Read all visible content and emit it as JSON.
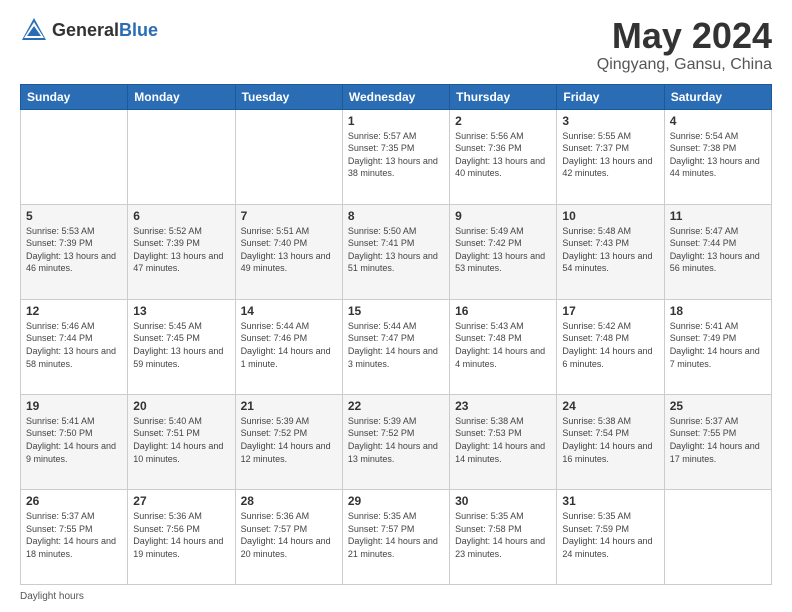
{
  "header": {
    "logo_general": "General",
    "logo_blue": "Blue",
    "month_title": "May 2024",
    "location": "Qingyang, Gansu, China"
  },
  "days_of_week": [
    "Sunday",
    "Monday",
    "Tuesday",
    "Wednesday",
    "Thursday",
    "Friday",
    "Saturday"
  ],
  "weeks": [
    [
      {
        "num": "",
        "sunrise": "",
        "sunset": "",
        "daylight": ""
      },
      {
        "num": "",
        "sunrise": "",
        "sunset": "",
        "daylight": ""
      },
      {
        "num": "",
        "sunrise": "",
        "sunset": "",
        "daylight": ""
      },
      {
        "num": "1",
        "sunrise": "Sunrise: 5:57 AM",
        "sunset": "Sunset: 7:35 PM",
        "daylight": "Daylight: 13 hours and 38 minutes."
      },
      {
        "num": "2",
        "sunrise": "Sunrise: 5:56 AM",
        "sunset": "Sunset: 7:36 PM",
        "daylight": "Daylight: 13 hours and 40 minutes."
      },
      {
        "num": "3",
        "sunrise": "Sunrise: 5:55 AM",
        "sunset": "Sunset: 7:37 PM",
        "daylight": "Daylight: 13 hours and 42 minutes."
      },
      {
        "num": "4",
        "sunrise": "Sunrise: 5:54 AM",
        "sunset": "Sunset: 7:38 PM",
        "daylight": "Daylight: 13 hours and 44 minutes."
      }
    ],
    [
      {
        "num": "5",
        "sunrise": "Sunrise: 5:53 AM",
        "sunset": "Sunset: 7:39 PM",
        "daylight": "Daylight: 13 hours and 46 minutes."
      },
      {
        "num": "6",
        "sunrise": "Sunrise: 5:52 AM",
        "sunset": "Sunset: 7:39 PM",
        "daylight": "Daylight: 13 hours and 47 minutes."
      },
      {
        "num": "7",
        "sunrise": "Sunrise: 5:51 AM",
        "sunset": "Sunset: 7:40 PM",
        "daylight": "Daylight: 13 hours and 49 minutes."
      },
      {
        "num": "8",
        "sunrise": "Sunrise: 5:50 AM",
        "sunset": "Sunset: 7:41 PM",
        "daylight": "Daylight: 13 hours and 51 minutes."
      },
      {
        "num": "9",
        "sunrise": "Sunrise: 5:49 AM",
        "sunset": "Sunset: 7:42 PM",
        "daylight": "Daylight: 13 hours and 53 minutes."
      },
      {
        "num": "10",
        "sunrise": "Sunrise: 5:48 AM",
        "sunset": "Sunset: 7:43 PM",
        "daylight": "Daylight: 13 hours and 54 minutes."
      },
      {
        "num": "11",
        "sunrise": "Sunrise: 5:47 AM",
        "sunset": "Sunset: 7:44 PM",
        "daylight": "Daylight: 13 hours and 56 minutes."
      }
    ],
    [
      {
        "num": "12",
        "sunrise": "Sunrise: 5:46 AM",
        "sunset": "Sunset: 7:44 PM",
        "daylight": "Daylight: 13 hours and 58 minutes."
      },
      {
        "num": "13",
        "sunrise": "Sunrise: 5:45 AM",
        "sunset": "Sunset: 7:45 PM",
        "daylight": "Daylight: 13 hours and 59 minutes."
      },
      {
        "num": "14",
        "sunrise": "Sunrise: 5:44 AM",
        "sunset": "Sunset: 7:46 PM",
        "daylight": "Daylight: 14 hours and 1 minute."
      },
      {
        "num": "15",
        "sunrise": "Sunrise: 5:44 AM",
        "sunset": "Sunset: 7:47 PM",
        "daylight": "Daylight: 14 hours and 3 minutes."
      },
      {
        "num": "16",
        "sunrise": "Sunrise: 5:43 AM",
        "sunset": "Sunset: 7:48 PM",
        "daylight": "Daylight: 14 hours and 4 minutes."
      },
      {
        "num": "17",
        "sunrise": "Sunrise: 5:42 AM",
        "sunset": "Sunset: 7:48 PM",
        "daylight": "Daylight: 14 hours and 6 minutes."
      },
      {
        "num": "18",
        "sunrise": "Sunrise: 5:41 AM",
        "sunset": "Sunset: 7:49 PM",
        "daylight": "Daylight: 14 hours and 7 minutes."
      }
    ],
    [
      {
        "num": "19",
        "sunrise": "Sunrise: 5:41 AM",
        "sunset": "Sunset: 7:50 PM",
        "daylight": "Daylight: 14 hours and 9 minutes."
      },
      {
        "num": "20",
        "sunrise": "Sunrise: 5:40 AM",
        "sunset": "Sunset: 7:51 PM",
        "daylight": "Daylight: 14 hours and 10 minutes."
      },
      {
        "num": "21",
        "sunrise": "Sunrise: 5:39 AM",
        "sunset": "Sunset: 7:52 PM",
        "daylight": "Daylight: 14 hours and 12 minutes."
      },
      {
        "num": "22",
        "sunrise": "Sunrise: 5:39 AM",
        "sunset": "Sunset: 7:52 PM",
        "daylight": "Daylight: 14 hours and 13 minutes."
      },
      {
        "num": "23",
        "sunrise": "Sunrise: 5:38 AM",
        "sunset": "Sunset: 7:53 PM",
        "daylight": "Daylight: 14 hours and 14 minutes."
      },
      {
        "num": "24",
        "sunrise": "Sunrise: 5:38 AM",
        "sunset": "Sunset: 7:54 PM",
        "daylight": "Daylight: 14 hours and 16 minutes."
      },
      {
        "num": "25",
        "sunrise": "Sunrise: 5:37 AM",
        "sunset": "Sunset: 7:55 PM",
        "daylight": "Daylight: 14 hours and 17 minutes."
      }
    ],
    [
      {
        "num": "26",
        "sunrise": "Sunrise: 5:37 AM",
        "sunset": "Sunset: 7:55 PM",
        "daylight": "Daylight: 14 hours and 18 minutes."
      },
      {
        "num": "27",
        "sunrise": "Sunrise: 5:36 AM",
        "sunset": "Sunset: 7:56 PM",
        "daylight": "Daylight: 14 hours and 19 minutes."
      },
      {
        "num": "28",
        "sunrise": "Sunrise: 5:36 AM",
        "sunset": "Sunset: 7:57 PM",
        "daylight": "Daylight: 14 hours and 20 minutes."
      },
      {
        "num": "29",
        "sunrise": "Sunrise: 5:35 AM",
        "sunset": "Sunset: 7:57 PM",
        "daylight": "Daylight: 14 hours and 21 minutes."
      },
      {
        "num": "30",
        "sunrise": "Sunrise: 5:35 AM",
        "sunset": "Sunset: 7:58 PM",
        "daylight": "Daylight: 14 hours and 23 minutes."
      },
      {
        "num": "31",
        "sunrise": "Sunrise: 5:35 AM",
        "sunset": "Sunset: 7:59 PM",
        "daylight": "Daylight: 14 hours and 24 minutes."
      },
      {
        "num": "",
        "sunrise": "",
        "sunset": "",
        "daylight": ""
      }
    ]
  ],
  "footer": {
    "daylight_hours": "Daylight hours"
  }
}
